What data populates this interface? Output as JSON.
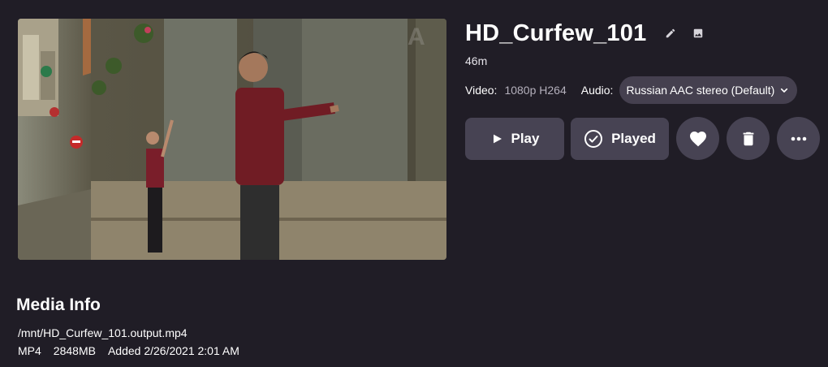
{
  "item": {
    "title": "HD_Curfew_101",
    "runtime": "46m"
  },
  "streams": {
    "video_label": "Video:",
    "video_value": "1080p H264",
    "audio_label": "Audio:",
    "audio_value": "Russian AAC stereo (Default)"
  },
  "actions": {
    "play_label": "Play",
    "played_label": "Played",
    "favorite_icon": "heart-icon",
    "delete_icon": "trash-icon",
    "more_icon": "more-horizontal-icon"
  },
  "media_info": {
    "heading": "Media Info",
    "path": "/mnt/HD_Curfew_101.output.mp4",
    "container": "MP4",
    "size": "2848MB",
    "added": "Added 2/26/2021 2:01 AM"
  },
  "thumbnail": {
    "watermark": "A"
  },
  "colors": {
    "background": "#201d26",
    "button": "#474353",
    "select": "#45404f",
    "muted_text": "#b4b0bc"
  }
}
